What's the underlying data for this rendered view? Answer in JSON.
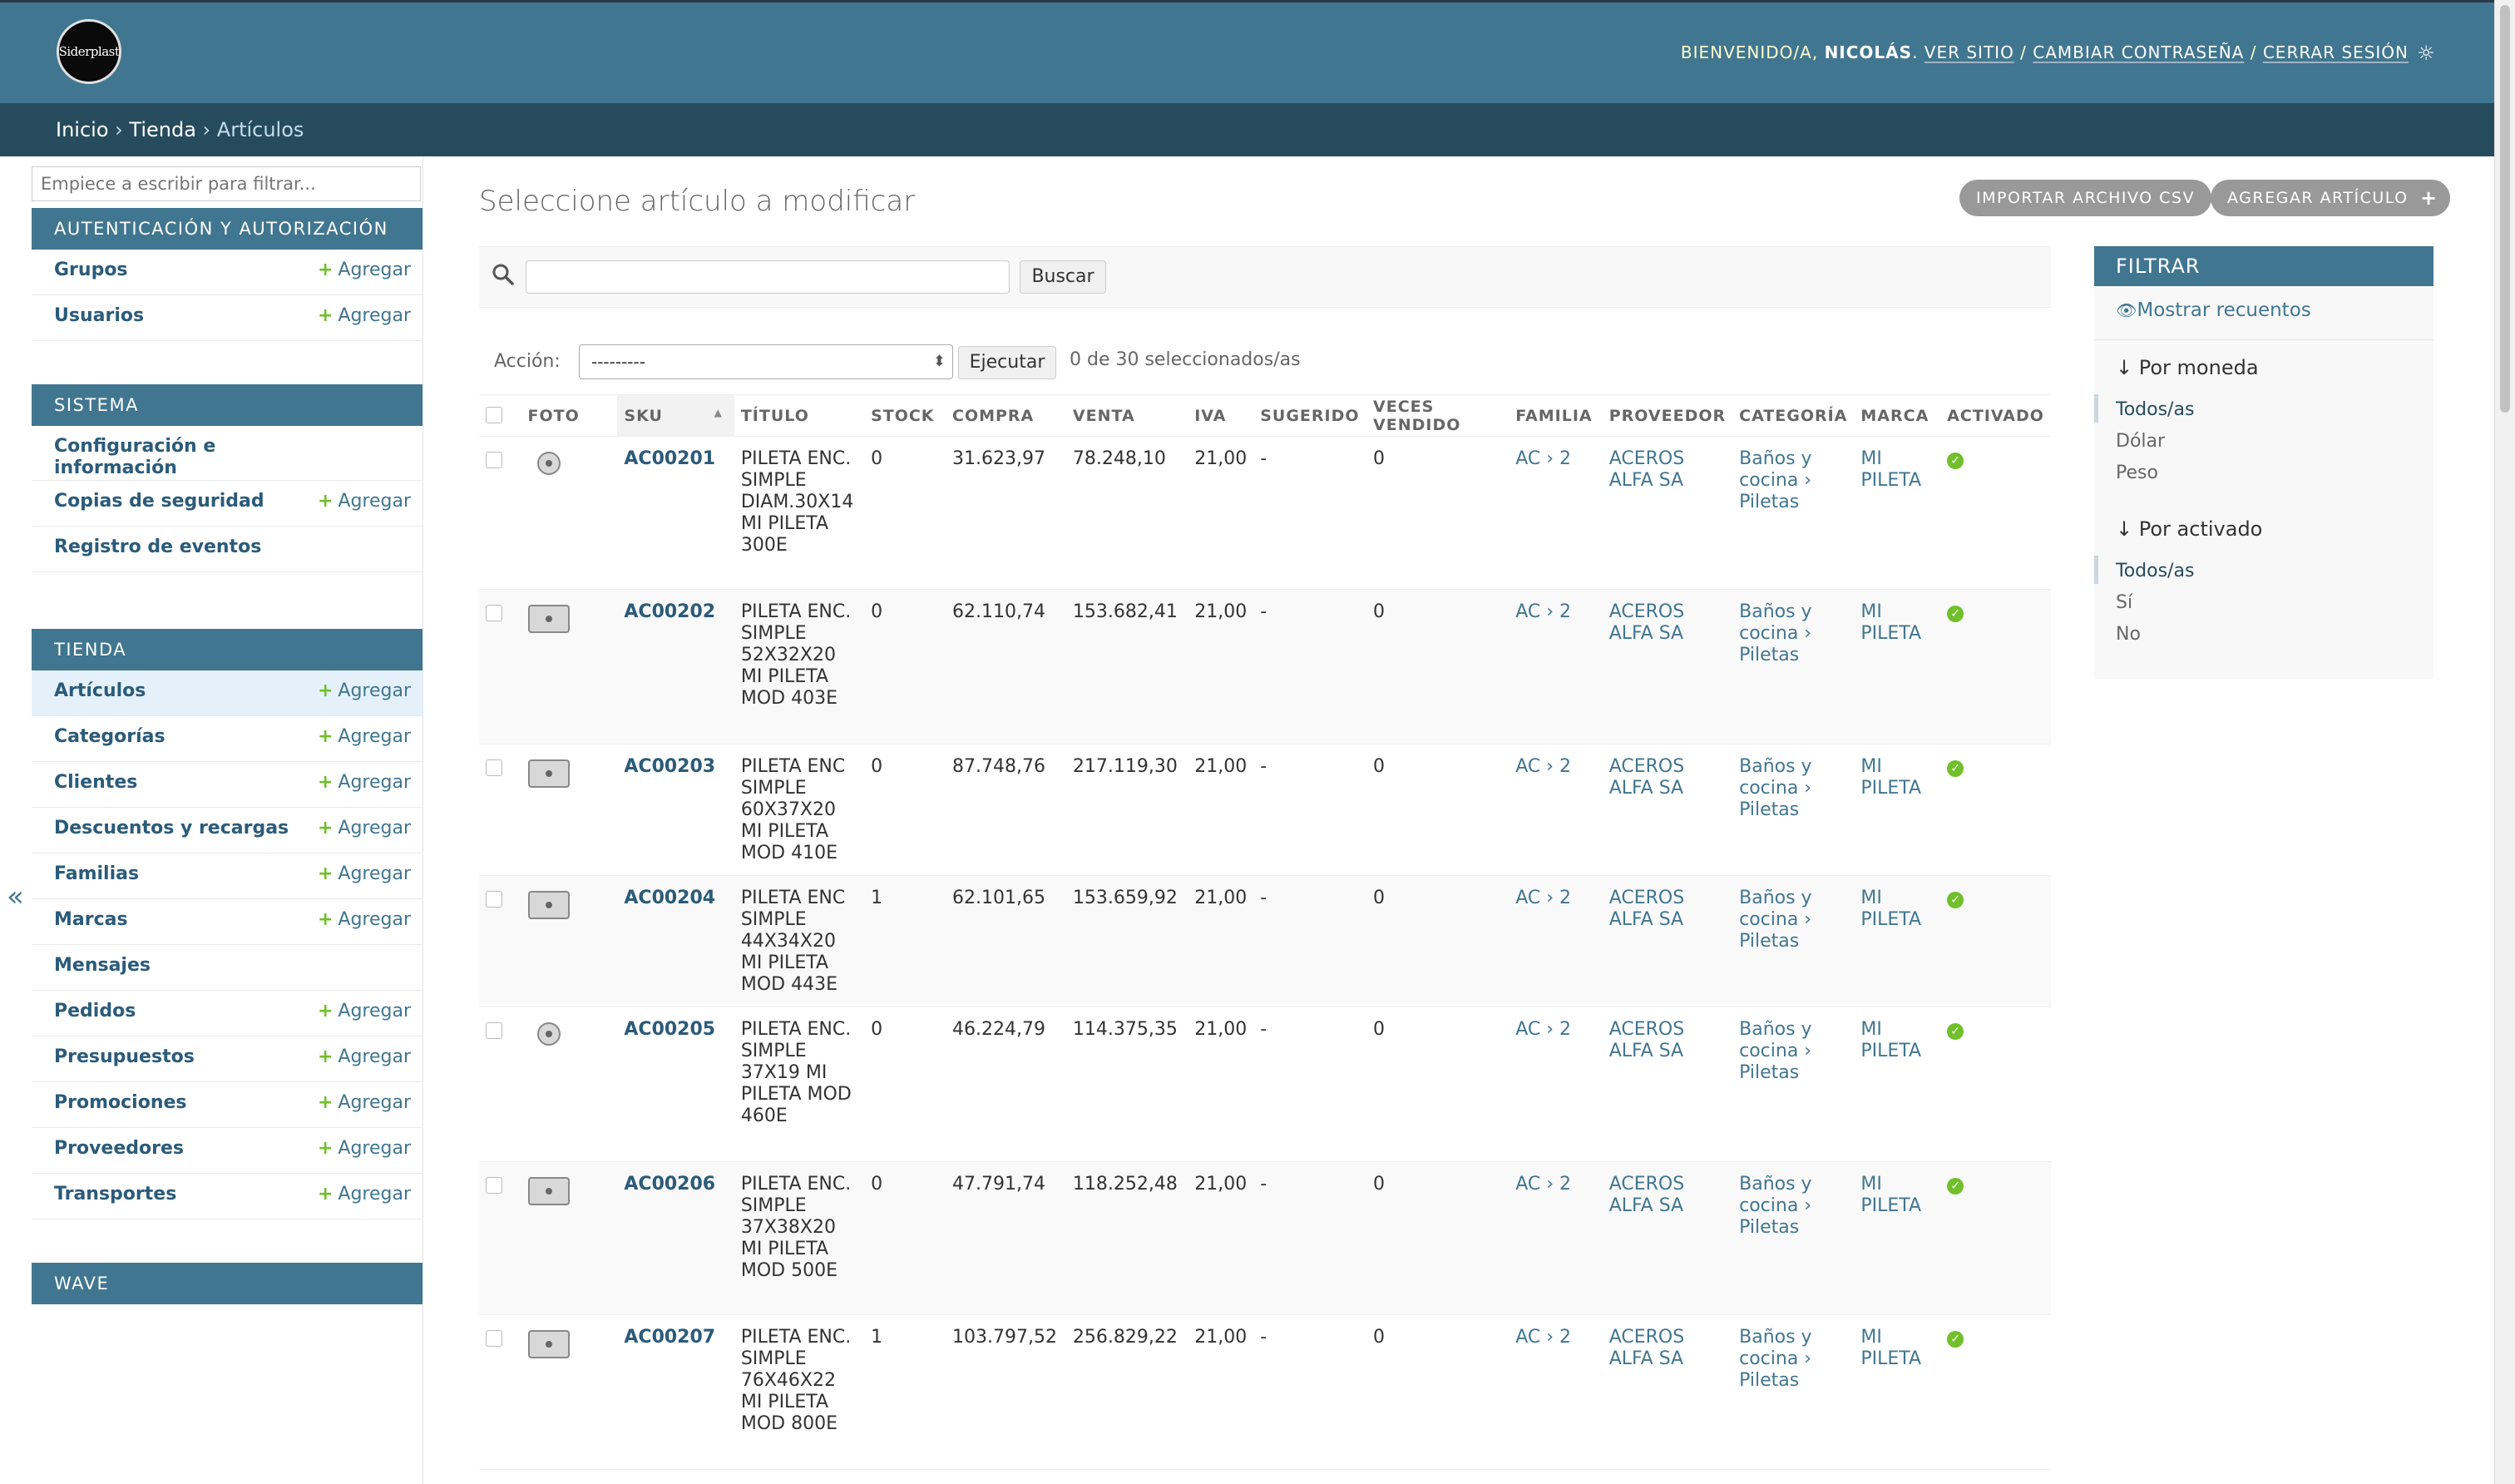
{
  "header": {
    "logo_text": "Siderplast",
    "welcome": "BIENVENIDO/A,",
    "username": "NICOLÁS",
    "links": [
      "VER SITIO",
      "CAMBIAR CONTRASEÑA",
      "CERRAR SESIÓN"
    ]
  },
  "breadcrumbs": [
    "Inicio",
    "Tienda",
    "Artículos"
  ],
  "nav": {
    "filter_placeholder": "Empiece a escribir para filtrar...",
    "add_label": "Agregar",
    "modules": [
      {
        "title": "AUTENTICACIÓN Y AUTORIZACIÓN",
        "items": [
          {
            "label": "Grupos",
            "add": true
          },
          {
            "label": "Usuarios",
            "add": true
          }
        ]
      },
      {
        "title": "SISTEMA",
        "items": [
          {
            "label": "Configuración e información",
            "add": false
          },
          {
            "label": "Copias de seguridad",
            "add": true
          },
          {
            "label": "Registro de eventos",
            "add": false
          }
        ]
      },
      {
        "title": "TIENDA",
        "items": [
          {
            "label": "Artículos",
            "add": true,
            "active": true
          },
          {
            "label": "Categorías",
            "add": true
          },
          {
            "label": "Clientes",
            "add": true
          },
          {
            "label": "Descuentos y recargas",
            "add": true
          },
          {
            "label": "Familias",
            "add": true
          },
          {
            "label": "Marcas",
            "add": true
          },
          {
            "label": "Mensajes",
            "add": false
          },
          {
            "label": "Pedidos",
            "add": true
          },
          {
            "label": "Presupuestos",
            "add": true
          },
          {
            "label": "Promociones",
            "add": true
          },
          {
            "label": "Proveedores",
            "add": true
          },
          {
            "label": "Transportes",
            "add": true
          }
        ]
      },
      {
        "title": "WAVE",
        "items": []
      }
    ]
  },
  "content": {
    "title": "Seleccione artículo a modificar",
    "import_button": "IMPORTAR ARCHIVO CSV",
    "add_button": "AGREGAR ARTÍCULO",
    "search_button": "Buscar",
    "search_value": "",
    "action_label": "Acción:",
    "action_selected": "---------",
    "run_button": "Ejecutar",
    "selected_count": "0 de 30 seleccionados/as"
  },
  "table": {
    "columns": [
      "FOTO",
      "SKU",
      "TÍTULO",
      "STOCK",
      "COMPRA",
      "VENTA",
      "IVA",
      "SUGERIDO",
      "VECES VENDIDO",
      "FAMILIA",
      "PROVEEDOR",
      "CATEGORÍA",
      "MARCA",
      "ACTIVADO"
    ],
    "rows": [
      {
        "sku": "AC00201",
        "title": "PILETA ENC. SIMPLE DIAM.30X14 MI PILETA 300E",
        "stock": "0",
        "compra": "31.623,97",
        "venta": "78.248,10",
        "iva": "21,00",
        "sugerido": "-",
        "vendido": "0",
        "familia": "AC › 2",
        "proveedor": "ACEROS ALFA SA",
        "categoria": "Baños y cocina › Piletas",
        "marca": "MI PILETA",
        "thumb": "round",
        "activado": true
      },
      {
        "sku": "AC00202",
        "title": "PILETA ENC. SIMPLE 52X32X20 MI PILETA MOD 403E",
        "stock": "0",
        "compra": "62.110,74",
        "venta": "153.682,41",
        "iva": "21,00",
        "sugerido": "-",
        "vendido": "0",
        "familia": "AC › 2",
        "proveedor": "ACEROS ALFA SA",
        "categoria": "Baños y cocina › Piletas",
        "marca": "MI PILETA",
        "thumb": "rect",
        "activado": true
      },
      {
        "sku": "AC00203",
        "title": "PILETA ENC SIMPLE 60X37X20 MI PILETA MOD 410E",
        "stock": "0",
        "compra": "87.748,76",
        "venta": "217.119,30",
        "iva": "21,00",
        "sugerido": "-",
        "vendido": "0",
        "familia": "AC › 2",
        "proveedor": "ACEROS ALFA SA",
        "categoria": "Baños y cocina › Piletas",
        "marca": "MI PILETA",
        "thumb": "rect",
        "activado": true
      },
      {
        "sku": "AC00204",
        "title": "PILETA ENC SIMPLE 44X34X20 MI PILETA MOD 443E",
        "stock": "1",
        "compra": "62.101,65",
        "venta": "153.659,92",
        "iva": "21,00",
        "sugerido": "-",
        "vendido": "0",
        "familia": "AC › 2",
        "proveedor": "ACEROS ALFA SA",
        "categoria": "Baños y cocina › Piletas",
        "marca": "MI PILETA",
        "thumb": "rect",
        "activado": true
      },
      {
        "sku": "AC00205",
        "title": "PILETA ENC. SIMPLE 37X19 MI PILETA MOD 460E",
        "stock": "0",
        "compra": "46.224,79",
        "venta": "114.375,35",
        "iva": "21,00",
        "sugerido": "-",
        "vendido": "0",
        "familia": "AC › 2",
        "proveedor": "ACEROS ALFA SA",
        "categoria": "Baños y cocina › Piletas",
        "marca": "MI PILETA",
        "thumb": "round",
        "activado": true
      },
      {
        "sku": "AC00206",
        "title": "PILETA ENC. SIMPLE 37X38X20 MI PILETA MOD 500E",
        "stock": "0",
        "compra": "47.791,74",
        "venta": "118.252,48",
        "iva": "21,00",
        "sugerido": "-",
        "vendido": "0",
        "familia": "AC › 2",
        "proveedor": "ACEROS ALFA SA",
        "categoria": "Baños y cocina › Piletas",
        "marca": "MI PILETA",
        "thumb": "rect",
        "activado": true
      },
      {
        "sku": "AC00207",
        "title": "PILETA ENC. SIMPLE 76X46X22 MI PILETA MOD 800E",
        "stock": "1",
        "compra": "103.797,52",
        "venta": "256.829,22",
        "iva": "21,00",
        "sugerido": "-",
        "vendido": "0",
        "familia": "AC › 2",
        "proveedor": "ACEROS ALFA SA",
        "categoria": "Baños y cocina › Piletas",
        "marca": "MI PILETA",
        "thumb": "rect",
        "activado": true
      }
    ]
  },
  "filter": {
    "title": "FILTRAR",
    "show_counts": "Mostrar recuentos",
    "groups": [
      {
        "title": "Por moneda",
        "options": [
          "Todos/as",
          "Dólar",
          "Peso"
        ]
      },
      {
        "title": "Por activado",
        "options": [
          "Todos/as",
          "Sí",
          "No"
        ]
      }
    ]
  },
  "colors": {
    "primary": "#417690",
    "dark": "#264b5d",
    "accent": "#70bf2b",
    "yellow": "#f5dd5d"
  }
}
